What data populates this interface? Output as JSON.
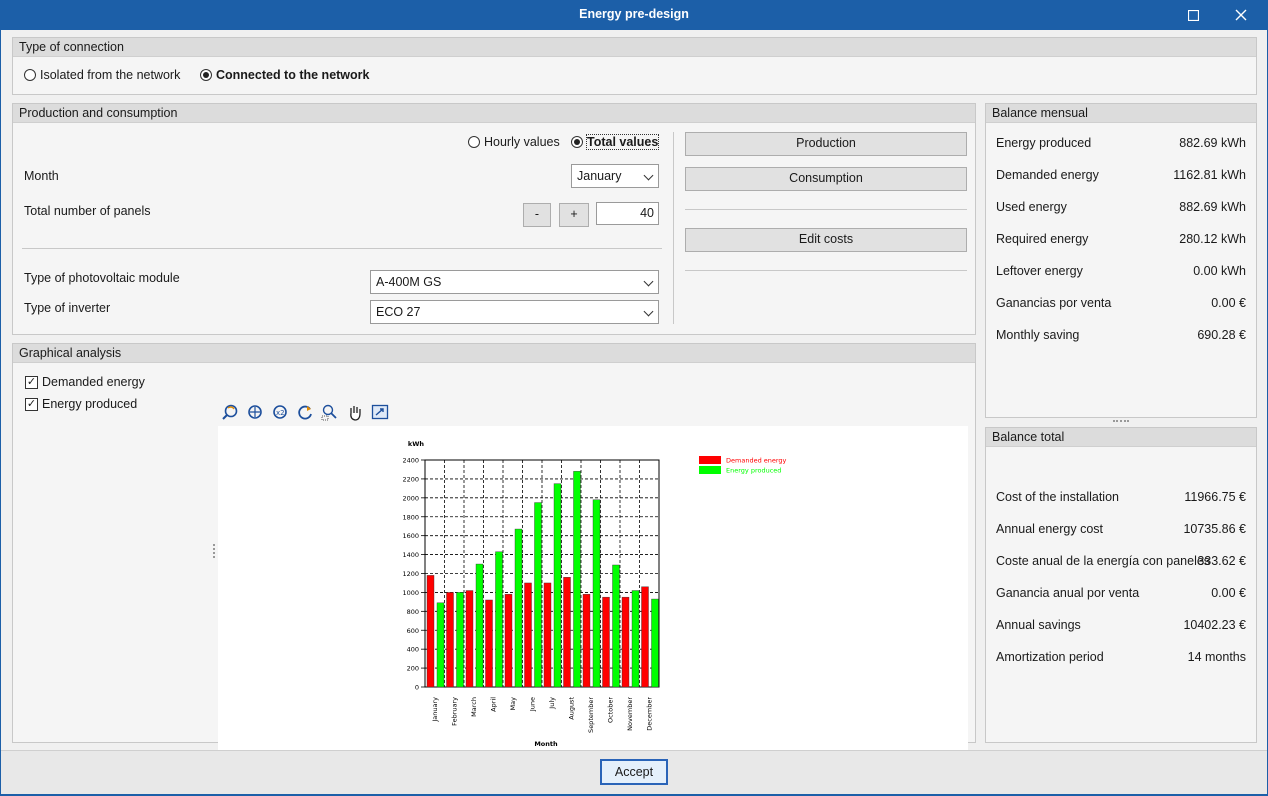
{
  "window": {
    "title": "Energy pre-design"
  },
  "connection": {
    "header": "Type of connection",
    "options": [
      "Isolated from the network",
      "Connected to the network"
    ],
    "selected": 1
  },
  "production": {
    "header": "Production and consumption",
    "mode_options": [
      "Hourly values",
      "Total values"
    ],
    "mode_selected": 1,
    "month_label": "Month",
    "month_value": "January",
    "panels_label": "Total number of panels",
    "minus": "-",
    "plus": "+",
    "panels_value": "40",
    "module_label": "Type of photovoltaic module",
    "module_value": "A-400M GS",
    "inverter_label": "Type of inverter",
    "inverter_value": "ECO 27",
    "btn_production": "Production",
    "btn_consumption": "Consumption",
    "btn_edit_costs": "Edit costs"
  },
  "graph": {
    "header": "Graphical analysis",
    "checks": [
      {
        "label": "Demanded energy",
        "checked": true
      },
      {
        "label": "Energy produced",
        "checked": true
      }
    ],
    "tools": [
      "zoom-undo-icon",
      "zoom-extents-icon",
      "zoom-x2-icon",
      "redraw-icon",
      "zoom-window-icon",
      "pan-hand-icon",
      "fit-view-icon"
    ]
  },
  "chart_data": {
    "type": "bar",
    "ylabel": "kWh",
    "xlabel": "Month",
    "ylim": [
      0,
      2400
    ],
    "yticks": [
      0,
      200,
      400,
      600,
      800,
      1000,
      1200,
      1400,
      1600,
      1800,
      2000,
      2200,
      2400
    ],
    "grid": true,
    "legend_position": "top-right",
    "categories": [
      "January",
      "February",
      "March",
      "April",
      "May",
      "June",
      "July",
      "August",
      "September",
      "October",
      "November",
      "December"
    ],
    "series": [
      {
        "name": "Demanded energy",
        "color": "#ff0000",
        "values": [
          1180,
          1000,
          1020,
          920,
          980,
          1100,
          1100,
          1160,
          980,
          950,
          950,
          1060
        ]
      },
      {
        "name": "Energy produced",
        "color": "#00ff00",
        "values": [
          890,
          1000,
          1300,
          1430,
          1670,
          1950,
          2150,
          2280,
          1980,
          1290,
          1020,
          930
        ]
      }
    ]
  },
  "balance_monthly": {
    "header": "Balance mensual",
    "rows": [
      {
        "k": "Energy produced",
        "v": "882.69  kWh"
      },
      {
        "k": "Demanded energy",
        "v": "1162.81  kWh"
      },
      {
        "k": "Used energy",
        "v": "882.69  kWh"
      },
      {
        "k": "Required energy",
        "v": "280.12  kWh"
      },
      {
        "k": "Leftover energy",
        "v": "0.00  kWh"
      },
      {
        "k": "Ganancias por venta",
        "v": "0.00  €"
      },
      {
        "k": "Monthly saving",
        "v": "690.28  €"
      }
    ]
  },
  "balance_total": {
    "header": "Balance total",
    "rows": [
      {
        "k": "Cost of the installation",
        "v": "11966.75  €"
      },
      {
        "k": "Annual energy cost",
        "v": "10735.86  €"
      },
      {
        "k": "Coste anual de la energía con paneles",
        "v": "333.62  €"
      },
      {
        "k": "Ganancia anual por venta",
        "v": "0.00  €"
      },
      {
        "k": "Annual savings",
        "v": "10402.23  €"
      },
      {
        "k": "Amortization period",
        "v": "14  months"
      }
    ]
  },
  "footer": {
    "accept": "Accept"
  }
}
